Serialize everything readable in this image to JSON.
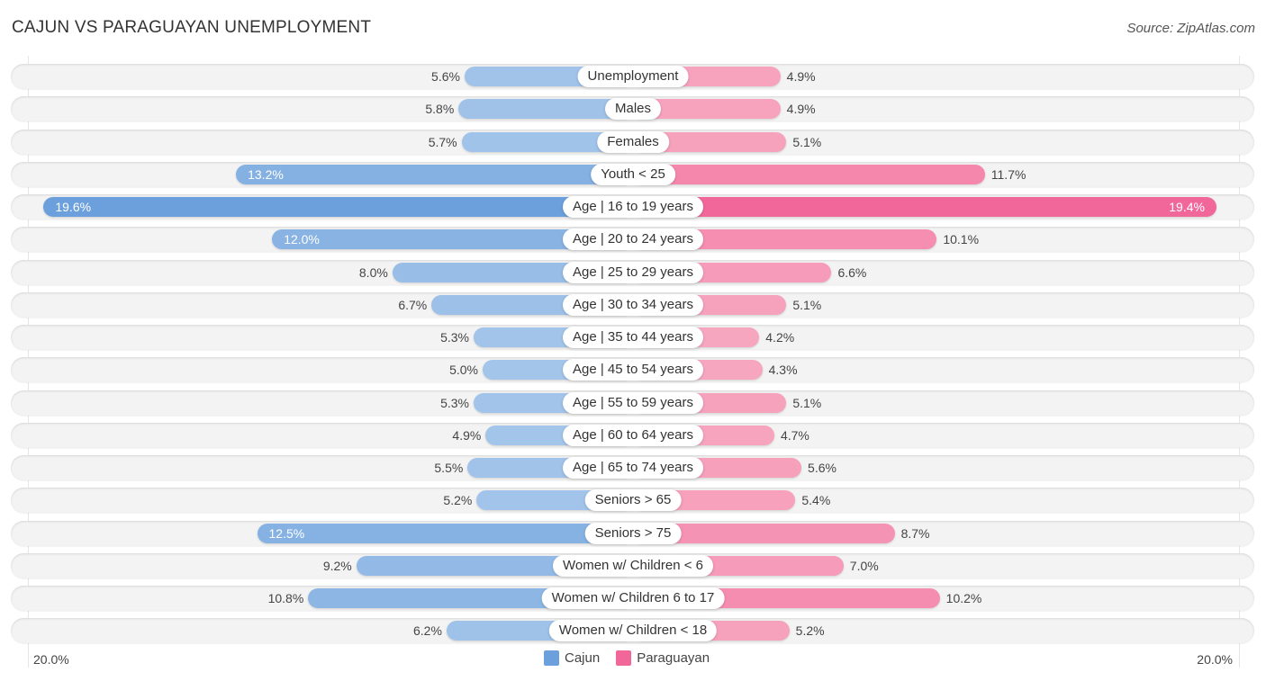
{
  "header": {
    "title": "CAJUN VS PARAGUAYAN UNEMPLOYMENT",
    "source": "Source: ZipAtlas.com"
  },
  "colors": {
    "cajun": "#6ba0dc",
    "cajun_light": "#a7c7eb",
    "paraguayan": "#f2679a",
    "paraguayan_light": "#f7a7c0"
  },
  "chart_data": {
    "type": "bar",
    "orientation": "horizontal-diverging",
    "title": "CAJUN VS PARAGUAYAN UNEMPLOYMENT",
    "xlabel": "",
    "ylabel": "",
    "xlim": [
      -20.0,
      20.0
    ],
    "axis_tick_labels": {
      "left": "20.0%",
      "right": "20.0%"
    },
    "legend": {
      "position": "bottom-center",
      "entries": [
        "Cajun",
        "Paraguayan"
      ]
    },
    "categories": [
      "Unemployment",
      "Males",
      "Females",
      "Youth < 25",
      "Age | 16 to 19 years",
      "Age | 20 to 24 years",
      "Age | 25 to 29 years",
      "Age | 30 to 34 years",
      "Age | 35 to 44 years",
      "Age | 45 to 54 years",
      "Age | 55 to 59 years",
      "Age | 60 to 64 years",
      "Age | 65 to 74 years",
      "Seniors > 65",
      "Seniors > 75",
      "Women w/ Children < 6",
      "Women w/ Children 6 to 17",
      "Women w/ Children < 18"
    ],
    "series": [
      {
        "name": "Cajun",
        "side": "left",
        "values": [
          5.6,
          5.8,
          5.7,
          13.2,
          19.6,
          12.0,
          8.0,
          6.7,
          5.3,
          5.0,
          5.3,
          4.9,
          5.5,
          5.2,
          12.5,
          9.2,
          10.8,
          6.2
        ],
        "labels": [
          "5.6%",
          "5.8%",
          "5.7%",
          "13.2%",
          "19.6%",
          "12.0%",
          "8.0%",
          "6.7%",
          "5.3%",
          "5.0%",
          "5.3%",
          "4.9%",
          "5.5%",
          "5.2%",
          "12.5%",
          "9.2%",
          "10.8%",
          "6.2%"
        ]
      },
      {
        "name": "Paraguayan",
        "side": "right",
        "values": [
          4.9,
          4.9,
          5.1,
          11.7,
          19.4,
          10.1,
          6.6,
          5.1,
          4.2,
          4.3,
          5.1,
          4.7,
          5.6,
          5.4,
          8.7,
          7.0,
          10.2,
          5.2
        ],
        "labels": [
          "4.9%",
          "4.9%",
          "5.1%",
          "11.7%",
          "19.4%",
          "10.1%",
          "6.6%",
          "5.1%",
          "4.2%",
          "4.3%",
          "5.1%",
          "4.7%",
          "5.6%",
          "5.4%",
          "8.7%",
          "7.0%",
          "10.2%",
          "5.2%"
        ]
      }
    ]
  }
}
